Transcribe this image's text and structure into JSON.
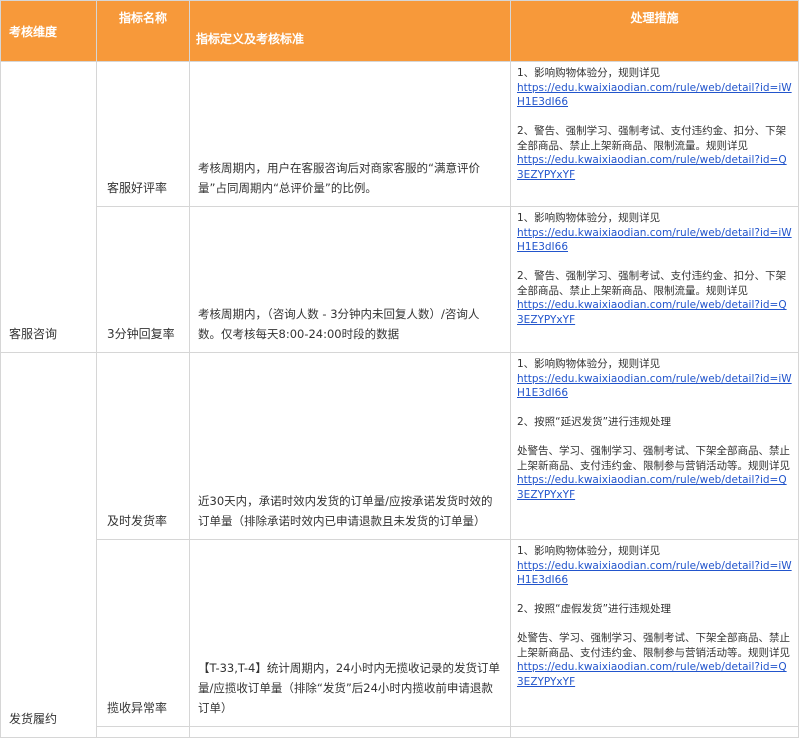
{
  "table": {
    "headers": {
      "dimension": "考核维度",
      "name": "指标名称",
      "definition": "指标定义及考核标准",
      "action": "处理措施"
    },
    "groups": {
      "service": "客服咨询",
      "fulfillment": "发货履约"
    },
    "rows": [
      {
        "name": "客服好评率",
        "definition": "考核周期内，用户在客服咨询后对商家客服的“满意评价量”占同周期内“总评价量”的比例。",
        "actions": {
          "a1_text": "1、影响购物体验分，规则详见",
          "a1_link": "https://edu.kwaixiaodian.com/rule/web/detail?id=iWH1E3dI66",
          "a2_text": "2、警告、强制学习、强制考试、支付违约金、扣分、下架全部商品、禁止上架新商品、限制流量。规则详见",
          "a2_link": "https://edu.kwaixiaodian.com/rule/web/detail?id=Q3EZYPYxYF"
        }
      },
      {
        "name": "3分钟回复率",
        "definition": "考核周期内，（咨询人数 - 3分钟内未回复人数）/咨询人数。仅考核每天8:00-24:00时段的数据",
        "actions": {
          "a1_text": "1、影响购物体验分，规则详见",
          "a1_link": "https://edu.kwaixiaodian.com/rule/web/detail?id=iWH1E3dI66",
          "a2_text": "2、警告、强制学习、强制考试、支付违约金、扣分、下架全部商品、禁止上架新商品、限制流量。规则详见",
          "a2_link": "https://edu.kwaixiaodian.com/rule/web/detail?id=Q3EZYPYxYF"
        }
      },
      {
        "name": "及时发货率",
        "definition": "近30天内，承诺时效内发货的订单量/应按承诺发货时效的订单量（排除承诺时效内已申请退款且未发货的订单量）",
        "actions": {
          "a1_text": "1、影响购物体验分，规则详见",
          "a1_link": "https://edu.kwaixiaodian.com/rule/web/detail?id=iWH1E3dI66",
          "a2_text": "2、按照“延迟发货”进行违规处理",
          "a3_text": "处警告、学习、强制学习、强制考试、下架全部商品、禁止上架新商品、支付违约金、限制参与营销活动等。规则详见",
          "a3_link": "https://edu.kwaixiaodian.com/rule/web/detail?id=Q3EZYPYxYF"
        }
      },
      {
        "name": "揽收异常率",
        "definition": "【T-33,T-4】统计周期内，24小时内无揽收记录的发货订单量/应揽收订单量（排除“发货”后24小时内揽收前申请退款订单）",
        "actions": {
          "a1_text": "1、影响购物体验分，规则详见",
          "a1_link": "https://edu.kwaixiaodian.com/rule/web/detail?id=iWH1E3dI66",
          "a2_text": "2、按照“虚假发货”进行违规处理",
          "a3_text": "处警告、学习、强制学习、强制考试、下架全部商品、禁止上架新商品、支付违约金、限制参与营销活动等。规则详见",
          "a3_link": "https://edu.kwaixiaodian.com/rule/web/detail?id=Q3EZYPYxYF"
        }
      }
    ]
  }
}
